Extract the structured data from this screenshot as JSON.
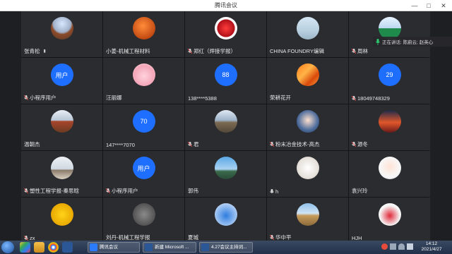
{
  "window": {
    "title": "腾讯会议",
    "minimize": "—",
    "maximize": "□",
    "close": "✕"
  },
  "participants": [
    {
      "name": "张青松",
      "avatar": "photo-great-wall",
      "signal": true
    },
    {
      "name": "小姜-机械工程材料",
      "avatar": "photo-basketball"
    },
    {
      "name": "郑红（焊接学报）",
      "avatar": "photo-red-flower",
      "muted": true
    },
    {
      "name": "CHINA FOUNDRY编辑",
      "avatar": "photo-person-lake"
    },
    {
      "name": "周林",
      "avatar": "photo-green-person",
      "muted": true
    },
    {
      "name": "小程序用户",
      "avatar_text": "用户",
      "muted": true
    },
    {
      "name": "汪丽娜",
      "avatar": "photo-pink-bear"
    },
    {
      "name": "138****5388",
      "avatar_text": "88"
    },
    {
      "name": "荣耕花开",
      "avatar": "photo-orange-abstract"
    },
    {
      "name": "18049748329",
      "avatar_text": "29",
      "muted": true
    },
    {
      "name": "温朝杰",
      "avatar": "photo-tree"
    },
    {
      "name": "147****7070",
      "avatar_text": "70"
    },
    {
      "name": "君",
      "avatar": "photo-hills",
      "muted": true
    },
    {
      "name": "粉末冶金技术-高杰",
      "avatar": "photo-anime-girl",
      "muted": true
    },
    {
      "name": "源冬",
      "avatar": "photo-sunset",
      "muted": true
    },
    {
      "name": "塑性工程学报-秦思晗",
      "avatar": "photo-beach-sky",
      "muted": true
    },
    {
      "name": "小程序用户",
      "avatar_text": "用户",
      "muted": true
    },
    {
      "name": "郭伟",
      "avatar": "photo-people-sky"
    },
    {
      "name": "h",
      "avatar": "photo-white-dog",
      "mic": true
    },
    {
      "name": "袁兴玲",
      "avatar": "photo-girl-white"
    },
    {
      "name": "zx",
      "avatar": "photo-smiley",
      "muted": true
    },
    {
      "name": "刘丹-机械工程学报",
      "avatar": "photo-cat"
    },
    {
      "name": "夏城",
      "avatar": "photo-blue-figure"
    },
    {
      "name": "华中平",
      "avatar": "photo-field",
      "muted": true
    },
    {
      "name": "HJH",
      "avatar": "photo-woman-red"
    }
  ],
  "speaking": {
    "text": "正在讲话: 陈蔚云; 赵英心"
  },
  "taskbar": {
    "tasks": [
      {
        "label": "腾讯会议",
        "color": "#2b7bff"
      },
      {
        "label": "新建 Microsoft ...",
        "color": "#2b5797"
      },
      {
        "label": "4.27会议主持词...",
        "color": "#2b5797"
      }
    ],
    "time": "14:12",
    "date": "2021/4/27"
  }
}
